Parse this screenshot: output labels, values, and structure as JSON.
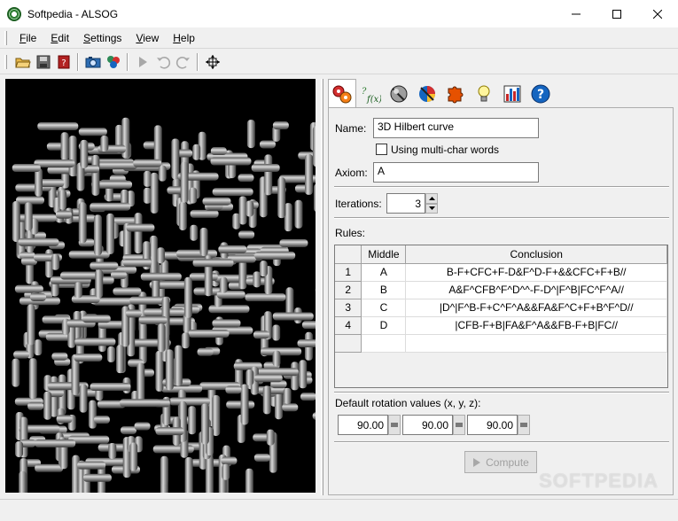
{
  "window": {
    "title": "Softpedia - ALSOG"
  },
  "menu": {
    "items": [
      {
        "first": "F",
        "rest": "ile"
      },
      {
        "first": "E",
        "rest": "dit"
      },
      {
        "first": "S",
        "rest": "ettings"
      },
      {
        "first": "V",
        "rest": "iew"
      },
      {
        "first": "H",
        "rest": "elp"
      }
    ]
  },
  "toolbar": {
    "icons": [
      "open-folder-icon",
      "save-icon",
      "help-book-icon",
      "camera-icon",
      "color-balls-icon",
      "play-icon",
      "undo-icon",
      "redo-icon",
      "move-crosshair-icon"
    ]
  },
  "tabs": {
    "icons": [
      "rules-gears-icon",
      "variables-fx-icon",
      "material-sphere-icon",
      "color-wheel-icon",
      "puzzle-icon",
      "lightbulb-icon",
      "chart-bars-icon",
      "help-question-icon"
    ]
  },
  "form": {
    "name_label": "Name:",
    "name_value": "3D Hilbert curve",
    "multichar_label": "Using multi-char words",
    "axiom_label": "Axiom:",
    "axiom_value": "A",
    "iterations_label": "Iterations:",
    "iterations_value": "3",
    "rules_label": "Rules:",
    "rotation_label": "Default rotation values (x, y, z):",
    "rotation_values": [
      "90.00",
      "90.00",
      "90.00"
    ],
    "compute_label": "Compute"
  },
  "rules_table": {
    "headers": [
      "Middle",
      "Conclusion"
    ],
    "rows": [
      {
        "index": "1",
        "middle": "A",
        "conclusion": "B-F+CFC+F-D&F^D-F+&&CFC+F+B//"
      },
      {
        "index": "2",
        "middle": "B",
        "conclusion": "A&F^CFB^F^D^^-F-D^|F^B|FC^F^A//"
      },
      {
        "index": "3",
        "middle": "C",
        "conclusion": "|D^|F^B-F+C^F^A&&FA&F^C+F+B^F^D//"
      },
      {
        "index": "4",
        "middle": "D",
        "conclusion": "|CFB-F+B|FA&F^A&&FB-F+B|FC//"
      }
    ]
  },
  "watermark": "SOFTPEDIA",
  "colors": {
    "viewport_bg": "#000000",
    "tube": "#9e9e9e",
    "window_bg": "#f0f0f0"
  }
}
